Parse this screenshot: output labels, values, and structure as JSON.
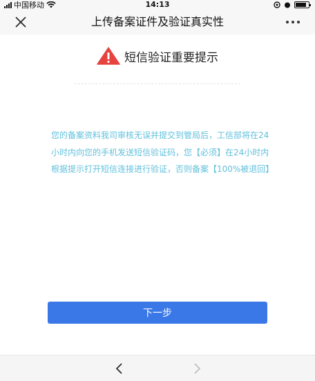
{
  "status_bar": {
    "carrier": "中国移动",
    "time": "14:13"
  },
  "nav_bar": {
    "title": "上传备案证件及验证真实性",
    "close_icon": "close-icon",
    "more_icon": "more-icon"
  },
  "heading": {
    "icon": "warning-icon",
    "icon_color": "#e64340",
    "text": "短信验证重要提示"
  },
  "notice": {
    "text": "您的备案资料我司审核无误并提交到管局后，工信部将在24小时内向您的手机发送短信验证码，您【必须】在24小时内根据提示打开短信连接进行验证，否则备案【100%被退回】",
    "color": "#62c0dc"
  },
  "next_button": {
    "label": "下一步",
    "color": "#3b78e7"
  },
  "bottom_bar": {
    "back_icon": "chevron-left-icon",
    "forward_icon": "chevron-right-icon"
  }
}
